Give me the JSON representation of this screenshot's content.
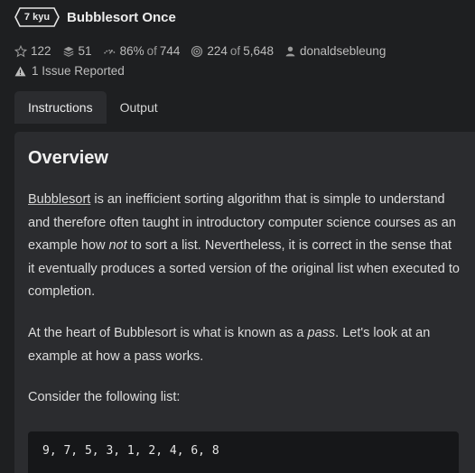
{
  "header": {
    "kyu_label": "7 kyu",
    "title": "Bubblesort Once"
  },
  "stats": {
    "favorites": "122",
    "collections": "51",
    "satisfaction": "86%",
    "satisfaction_of": "of",
    "satisfaction_votes": "744",
    "completed": "224",
    "completed_of": "of",
    "attempts": "5,648",
    "author": "donaldsebleung"
  },
  "issues": {
    "label": "1 Issue Reported"
  },
  "tabs": [
    {
      "label": "Instructions",
      "active": true
    },
    {
      "label": "Output",
      "active": false
    }
  ],
  "content": {
    "heading": "Overview",
    "p1_link": "Bubblesort",
    "p1_text_a": " is an inefficient sorting algorithm that is simple to understand and therefore often taught in introductory computer science courses as an example how ",
    "p1_em": "not",
    "p1_text_b": " to sort a list. Nevertheless, it is correct in the sense that it eventually produces a sorted version of the original list when executed to completion.",
    "p2_text_a": "At the heart of Bubblesort is what is known as a ",
    "p2_em": "pass",
    "p2_text_b": ". Let's look at an example at how a pass works.",
    "p3_text": "Consider the following list:",
    "code": "9, 7, 5, 3, 1, 2, 4, 6, 8"
  },
  "colors": {
    "background": "#1e1f21",
    "panel": "#2b2c2f",
    "code_bg": "#161719"
  },
  "icons": [
    "star-icon",
    "collections-icon",
    "satisfaction-icon",
    "target-icon",
    "user-icon",
    "warning-icon"
  ]
}
